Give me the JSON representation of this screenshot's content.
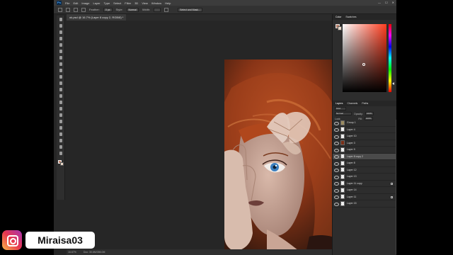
{
  "app": {
    "menu": [
      "File",
      "Edit",
      "Image",
      "Layer",
      "Type",
      "Select",
      "Filter",
      "3D",
      "View",
      "Window",
      "Help"
    ],
    "window_controls": [
      "—",
      "☐",
      "✕"
    ]
  },
  "options_bar": {
    "opacity_label": "Opacity:",
    "flow_label": "Flow:",
    "style_label": "Style:",
    "style_value": "Normal",
    "width_label": "Width:",
    "feather_label": "Feather:",
    "feather_value": "0 px",
    "select_mask": "Select and Mask..."
  },
  "document": {
    "tab_title": "ok.psd @ 16.7% (Layer 8 copy 2, RGB/8) *"
  },
  "status": {
    "zoom": "16.67%",
    "doc_info": "Doc: 30.6M/356.0M"
  },
  "colors": {
    "foreground": "#c0856d",
    "background": "#e9d8c8"
  },
  "color_panel": {
    "tabs": [
      "Color",
      "Swatches"
    ]
  },
  "layers_panel": {
    "tabs": [
      "Layers",
      "Channels",
      "Paths"
    ],
    "kind_filter": "Kind",
    "blend_mode": "Normal",
    "opacity_label": "Opacity:",
    "opacity_value": "100%",
    "lock_label": "Lock:",
    "fill_label": "Fill:",
    "fill_value": "100%",
    "layers": [
      {
        "name": "Group 1",
        "thumb": "folder",
        "selected": false,
        "locked": false
      },
      {
        "name": "Layer 4",
        "thumb": "trans",
        "selected": false,
        "locked": false
      },
      {
        "name": "Layer 10",
        "thumb": "trans",
        "selected": false,
        "locked": false
      },
      {
        "name": "Layer 3",
        "thumb": "hair",
        "selected": false,
        "locked": false
      },
      {
        "name": "Layer 9",
        "thumb": "trans",
        "selected": false,
        "locked": false
      },
      {
        "name": "Layer 8 copy 2",
        "thumb": "trans",
        "selected": true,
        "locked": false
      },
      {
        "name": "Layer 8",
        "thumb": "trans",
        "selected": false,
        "locked": false
      },
      {
        "name": "Layer 12",
        "thumb": "trans",
        "selected": false,
        "locked": false
      },
      {
        "name": "Layer 13",
        "thumb": "trans",
        "selected": false,
        "locked": false
      },
      {
        "name": "Layer 11 copy",
        "thumb": "trans",
        "selected": false,
        "locked": true
      },
      {
        "name": "Layer 14",
        "thumb": "trans",
        "selected": false,
        "locked": false
      },
      {
        "name": "Layer 11",
        "thumb": "trans",
        "selected": false,
        "locked": true
      },
      {
        "name": "Layer 15",
        "thumb": "trans",
        "selected": false,
        "locked": false
      }
    ]
  },
  "watermark": {
    "username": "Miraisa03"
  }
}
